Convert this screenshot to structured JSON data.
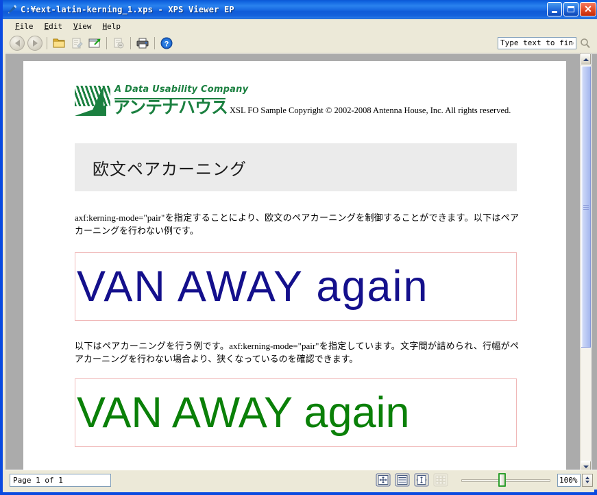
{
  "window": {
    "title": "C:\\ext-latin-kerning_1.xps - XPS Viewer EP",
    "title_display": "C:¥ext-latin-kerning_1.xps - XPS Viewer EP",
    "icon": "document-pen-icon",
    "minimize_label": "_",
    "maximize_label": "□",
    "close_label": "✕"
  },
  "menubar": {
    "items": [
      {
        "label": "File",
        "accel": "F",
        "rest": "ile"
      },
      {
        "label": "Edit",
        "accel": "E",
        "rest": "dit"
      },
      {
        "label": "View",
        "accel": "V",
        "rest": "iew"
      },
      {
        "label": "Help",
        "accel": "H",
        "rest": "elp"
      }
    ]
  },
  "toolbar": {
    "buttons": [
      {
        "name": "back-button",
        "icon": "arrow-left-icon",
        "enabled": false
      },
      {
        "name": "forward-button",
        "icon": "arrow-right-icon",
        "enabled": false
      },
      {
        "name": "open-button",
        "icon": "folder-icon",
        "enabled": true
      },
      {
        "name": "permissions-button",
        "icon": "document-signature-icon",
        "enabled": false
      },
      {
        "name": "digital-signature-button",
        "icon": "window-arrow-icon",
        "enabled": true
      },
      {
        "name": "page-properties-button",
        "icon": "document-minus-icon",
        "enabled": false
      },
      {
        "name": "print-button",
        "icon": "printer-icon",
        "enabled": true
      },
      {
        "name": "help-button",
        "icon": "question-circle-icon",
        "enabled": true
      }
    ],
    "search": {
      "placeholder": "Type text to find…",
      "value": "",
      "button_icon": "magnifier-icon"
    }
  },
  "document": {
    "logo": {
      "tagline": "A Data Usability Company",
      "company_jp": "アンテナハウス",
      "color": "#1b8040"
    },
    "copyright": "XSL FO Sample Copyright © 2002-2008 Antenna House, Inc. All rights reserved.",
    "title_band": {
      "text": "欧文ペアカーニング",
      "background": "#ebebeb"
    },
    "paragraphs": [
      "axf:kerning-mode=\"pair\"を指定することにより、欧文のペアカーニングを制御することができます。以下はペアカーニングを行わない例です。",
      "以下はペアカーニングを行う例です。axf:kerning-mode=\"pair\"を指定しています。文字間が詰められ、行幅がペアカーニングを行わない場合より、狭くなっているのを確認できます。"
    ],
    "samples": [
      {
        "text": "VAN AWAY again",
        "color": "#14108c",
        "border_color": "#f0b8b8",
        "kerning": "none"
      },
      {
        "text": "VAN AWAY again",
        "color": "#0a8008",
        "border_color": "#f0b8b8",
        "kerning": "pair"
      }
    ]
  },
  "scrollbar": {
    "up_icon": "caret-up-icon",
    "down_icon": "caret-down-icon",
    "thumb_name": "vertical-scroll-thumb"
  },
  "statusbar": {
    "page_value": "Page 1 of 1",
    "view_buttons": [
      {
        "name": "fit-page-button",
        "icon": "fit-page-icon",
        "enabled": true
      },
      {
        "name": "fit-width-button",
        "icon": "fit-width-icon",
        "enabled": true
      },
      {
        "name": "fit-height-button",
        "icon": "fit-height-icon",
        "enabled": true
      },
      {
        "name": "thumbnail-view-button",
        "icon": "grid-thumbnails-icon",
        "enabled": false
      }
    ],
    "zoom_value": "100%",
    "zoom_slider_percent": 45
  }
}
